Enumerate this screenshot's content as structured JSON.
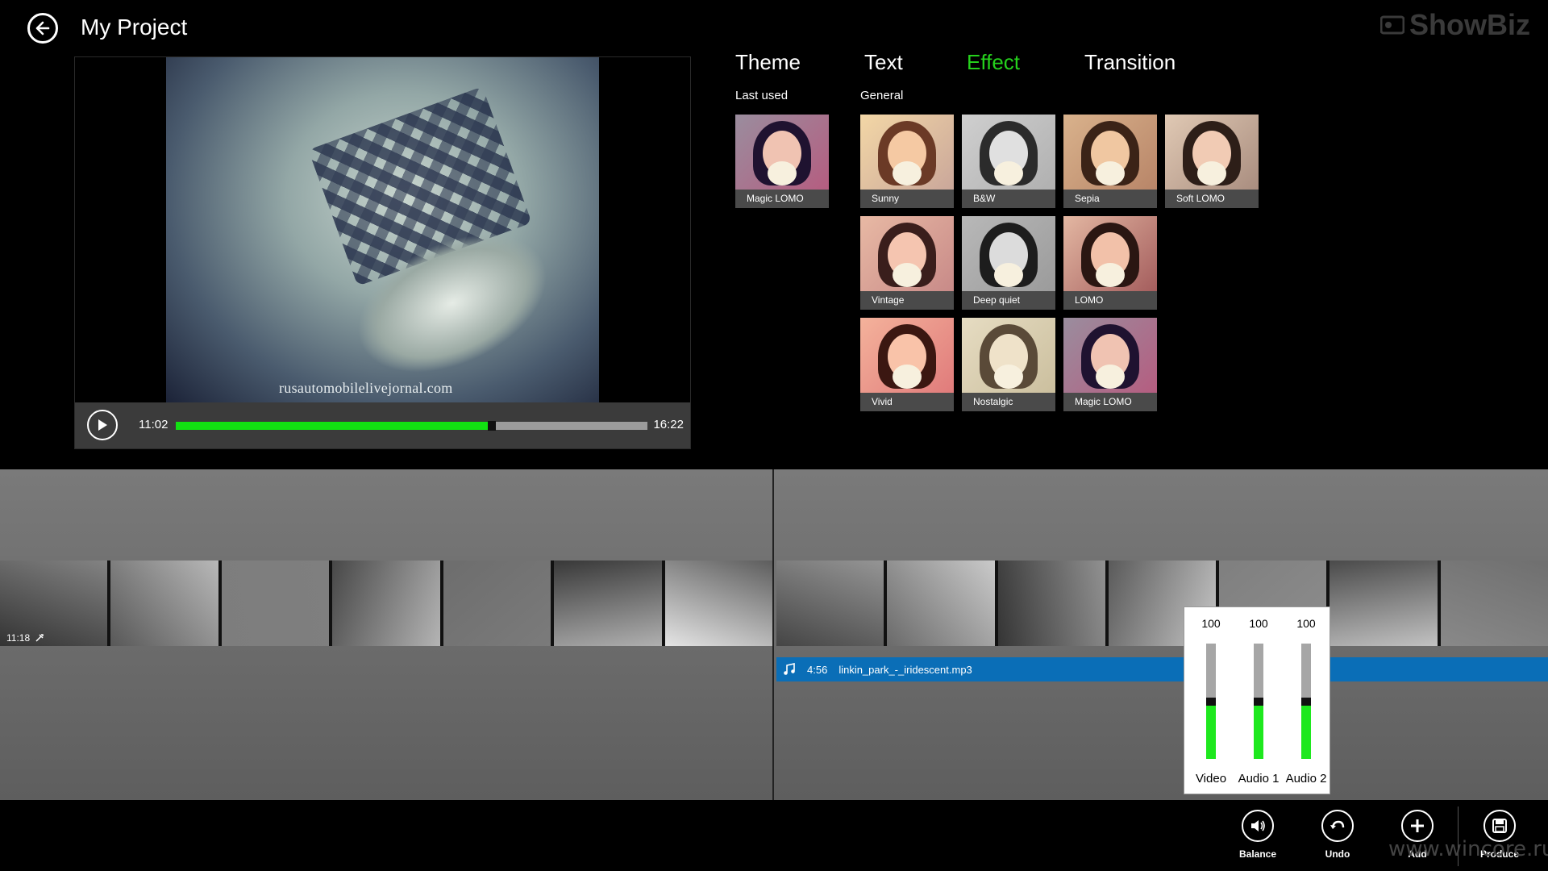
{
  "header": {
    "title": "My Project",
    "brand": "ShowBiz"
  },
  "player": {
    "watermark": "rusautomobilelivejornal.com",
    "current_time": "11:02",
    "total_time": "16:22",
    "progress": 0.67
  },
  "tabs": [
    {
      "label": "Theme",
      "active": false
    },
    {
      "label": "Text",
      "active": false
    },
    {
      "label": "Effect",
      "active": true
    },
    {
      "label": "Transition",
      "active": false
    }
  ],
  "effects": {
    "last_used_label": "Last used",
    "general_label": "General",
    "last_used": [
      {
        "label": "Magic LOMO",
        "tone": "magic"
      }
    ],
    "general": [
      {
        "label": "Sunny",
        "tone": "sunny"
      },
      {
        "label": "B&W",
        "tone": "bw"
      },
      {
        "label": "Sepia",
        "tone": "sepia"
      },
      {
        "label": "Soft LOMO",
        "tone": "soft"
      },
      {
        "label": "Vintage",
        "tone": "vintage"
      },
      {
        "label": "Deep quiet",
        "tone": "deep"
      },
      {
        "label": "LOMO",
        "tone": "lomo"
      },
      {
        "label": "Vivid",
        "tone": "vivid"
      },
      {
        "label": "Nostalgic",
        "tone": "nostalgic"
      },
      {
        "label": "Magic LOMO",
        "tone": "magic"
      }
    ]
  },
  "timeline": {
    "clip_time": "11:18",
    "audio_duration": "4:56",
    "audio_file": "linkin_park_-_iridescent.mp3"
  },
  "balance": [
    {
      "label": "Video",
      "value": "100",
      "level": 0.5
    },
    {
      "label": "Audio 1",
      "value": "100",
      "level": 0.5
    },
    {
      "label": "Audio 2",
      "value": "100",
      "level": 0.5
    }
  ],
  "appbar": [
    {
      "label": "Balance",
      "icon": "speaker-icon"
    },
    {
      "label": "Undo",
      "icon": "undo-icon"
    },
    {
      "label": "Add",
      "icon": "plus-icon"
    },
    {
      "label": "Produce",
      "icon": "save-icon"
    }
  ],
  "site_watermark": "www.wincore.ru"
}
